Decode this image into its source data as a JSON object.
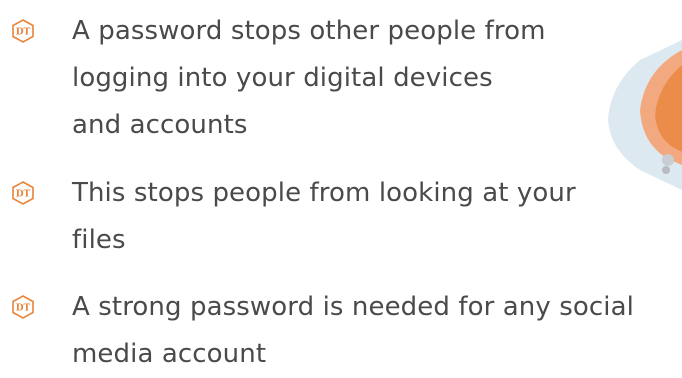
{
  "colors": {
    "accent": "#e8833a",
    "text": "#4a4a4a",
    "decor_peach": "#f2a57a",
    "decor_blue": "#cfe0ec"
  },
  "bullet_icon": {
    "name": "dt-hexagon-icon",
    "label": "DT"
  },
  "bullets": [
    {
      "lines": [
        "A password stops other people from",
        "logging into your digital devices",
        "and accounts"
      ]
    },
    {
      "lines": [
        "This stops people from looking at your",
        "files"
      ]
    },
    {
      "lines": [
        "A strong password is needed for any social",
        "media account"
      ]
    }
  ]
}
